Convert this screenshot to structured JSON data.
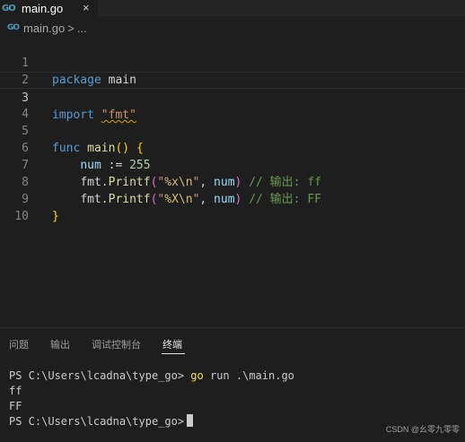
{
  "tab": {
    "icon": "go-file-icon",
    "label": "main.go",
    "close": "×"
  },
  "breadcrumb": {
    "file": "main.go",
    "separator": ">",
    "more": "..."
  },
  "editor": {
    "line_numbers": [
      "1",
      "2",
      "3",
      "4",
      "5",
      "6",
      "7",
      "8",
      "9",
      "10"
    ],
    "current_line": 3,
    "lines": {
      "l1_kw": "package",
      "l1_name": " main",
      "l3_kw": "import",
      "l3_str": "\"fmt\"",
      "l5_kw": "func",
      "l5_fn": "main",
      "l5_open": "(",
      "l5_close": ")",
      "l5_brace": "{",
      "l6_var": "num",
      "l6_op": " := ",
      "l6_num": "255",
      "l7_pkg": "fmt.",
      "l7_fn": "Printf",
      "l7_open": "(",
      "l7_q1": "\"",
      "l7_fmt": "%x\\n",
      "l7_q2": "\"",
      "l7_sep": ", ",
      "l7_var": "num",
      "l7_close": ")",
      "l7_comment": "// 输出: ff",
      "l8_pkg": "fmt.",
      "l8_fn": "Printf",
      "l8_open": "(",
      "l8_q1": "\"",
      "l8_fmt": "%X\\n",
      "l8_q2": "\"",
      "l8_sep": ", ",
      "l8_var": "num",
      "l8_close": ")",
      "l8_comment": "// 输出: FF",
      "l9_brace": "}"
    }
  },
  "panel": {
    "tabs": [
      "问题",
      "输出",
      "调试控制台",
      "终端"
    ],
    "active_tab": "终端"
  },
  "terminal": {
    "prompt1": "PS C:\\Users\\lcadna\\type_go> ",
    "cmd_go": "go",
    "cmd_rest": " run .\\main.go",
    "out1": "ff",
    "out2": "FF",
    "prompt2": "PS C:\\Users\\lcadna\\type_go>"
  },
  "watermark": "CSDN @幺零九零零",
  "colors": {
    "background": "#1e1e1e",
    "keyword": "#569cd6",
    "string": "#ce9178",
    "comment": "#6a9955",
    "function": "#dcdcaa"
  }
}
